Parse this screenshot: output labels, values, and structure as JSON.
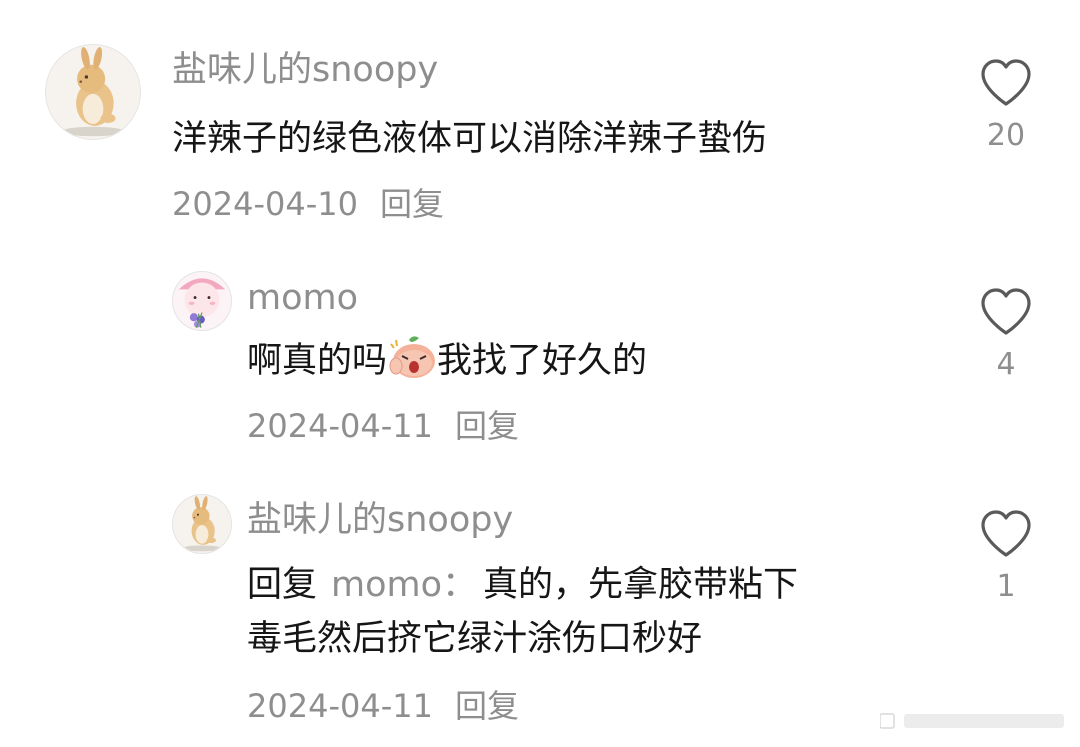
{
  "comments": [
    {
      "username": "盐味儿的snoopy",
      "text": "洋辣子的绿色液体可以消除洋辣子蛰伤",
      "date": "2024-04-10",
      "reply_label": "回复",
      "likes": "20",
      "avatar": "bunny-avatar"
    },
    {
      "username": "momo",
      "text_before": "啊真的吗",
      "text_after": "我找了好久的",
      "emoji": "angry-peach-emoji",
      "date": "2024-04-11",
      "reply_label": "回复",
      "likes": "4",
      "avatar": "peach-bouquet-avatar"
    },
    {
      "username": "盐味儿的snoopy",
      "reply_prefix": "回复",
      "reply_target": "momo：",
      "text_line1": "真的，先拿胶带粘下",
      "text_line2": "毒毛然后挤它绿汁涂伤口秒好",
      "date": "2024-04-11",
      "reply_label": "回复",
      "likes": "1",
      "avatar": "bunny-avatar"
    }
  ],
  "icons": {
    "like": "heart-outline-icon"
  },
  "colors": {
    "text": "#161616",
    "muted": "#8e8e8e",
    "background": "#ffffff"
  }
}
